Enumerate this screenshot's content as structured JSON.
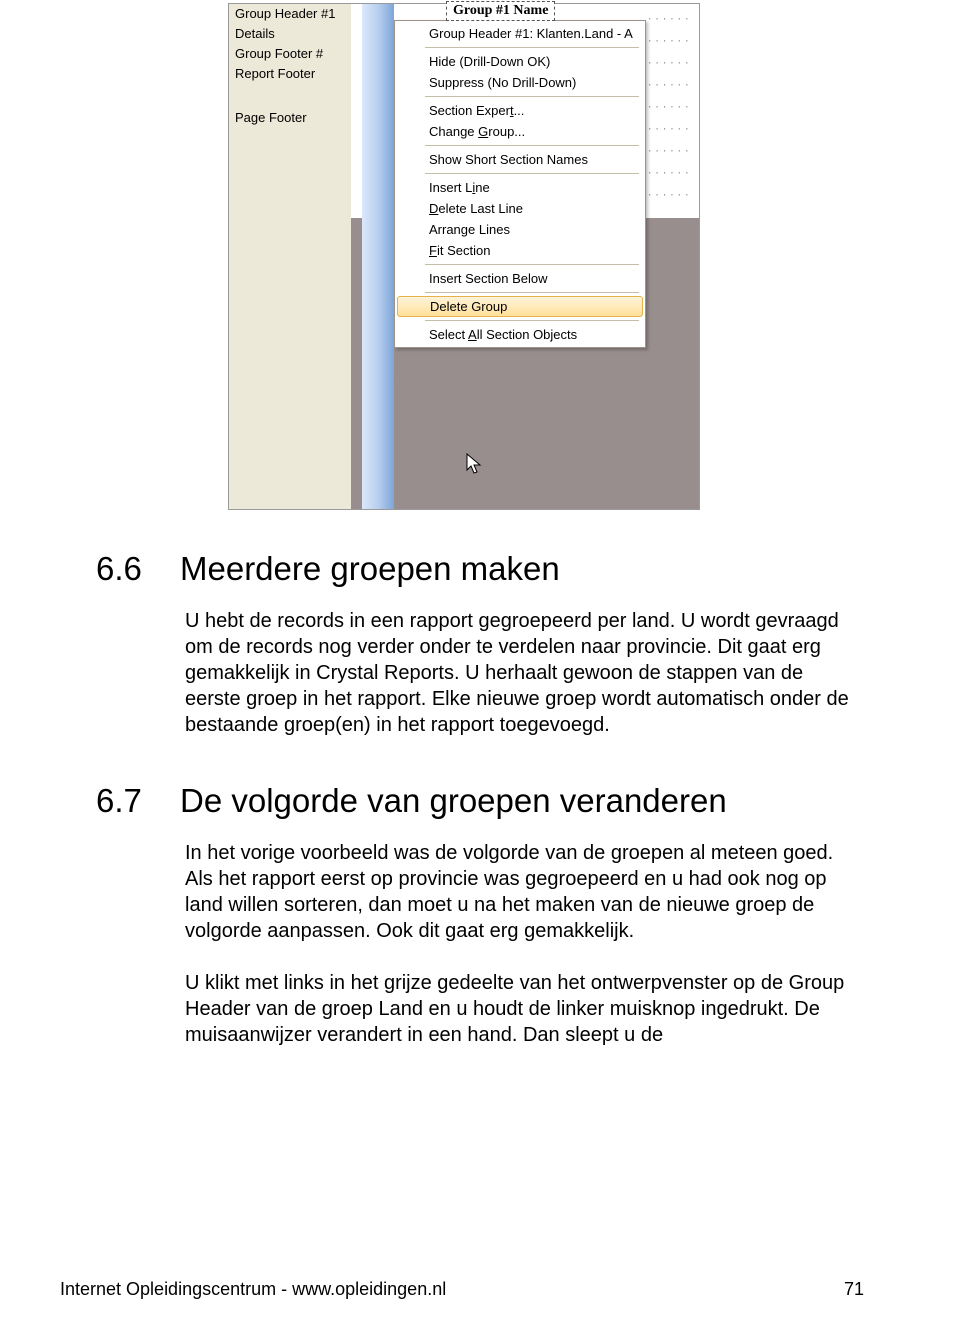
{
  "screenshot": {
    "sections": [
      "Group Header #1",
      "Details",
      "Group Footer #",
      "Report Footer",
      "",
      "Page Footer"
    ],
    "group_label": "Group #1 Name",
    "menu": {
      "header": "Group Header #1: Klanten.Land - A",
      "items1": [
        "Hide (Drill-Down OK)",
        "Suppress (No Drill-Down)"
      ],
      "items2_html": [
        "Section Exper<span class='u'>t</span>...",
        "Change <span class='u'>G</span>roup..."
      ],
      "items3": [
        "Show Short Section Names"
      ],
      "items4_html": [
        "Insert L<span class='u'>i</span>ne",
        "<span class='u'>D</span>elete Last Line",
        "Arrange Lines",
        "<span class='u'>F</span>it Section"
      ],
      "items5": [
        "Insert Section Below"
      ],
      "highlight": "Delete Group",
      "items6_html": [
        "Select <span class='u'>A</span>ll Section Objects"
      ]
    }
  },
  "sect66": {
    "num": "6.6",
    "title": "Meerdere groepen maken",
    "p1": "U hebt de records in een rapport gegroepeerd per land. U wordt gevraagd om de records nog verder onder te verdelen naar provincie. Dit gaat erg gemakkelijk in Crystal Reports. U herhaalt gewoon de stappen van de eerste groep in het rapport. Elke nieuwe groep wordt automatisch onder de bestaande groep(en) in het rapport toegevoegd."
  },
  "sect67": {
    "num": "6.7",
    "title": "De volgorde van groepen veranderen",
    "p1": "In het vorige voorbeeld was de volgorde van de groepen al meteen goed. Als het rapport eerst op provincie was gegroepeerd en u had ook nog op land willen sorteren, dan moet u na het maken van de nieuwe groep de volgorde aanpassen. Ook dit gaat erg gemakkelijk.",
    "p2": "U klikt met links in het grijze gedeelte van het ontwerpvenster op de Group Header van de groep Land en u houdt de linker muisknop ingedrukt. De muisaanwijzer verandert in een hand. Dan sleept u de"
  },
  "footer": {
    "left": "Internet Opleidingscentrum - www.opleidingen.nl",
    "right": "71"
  }
}
